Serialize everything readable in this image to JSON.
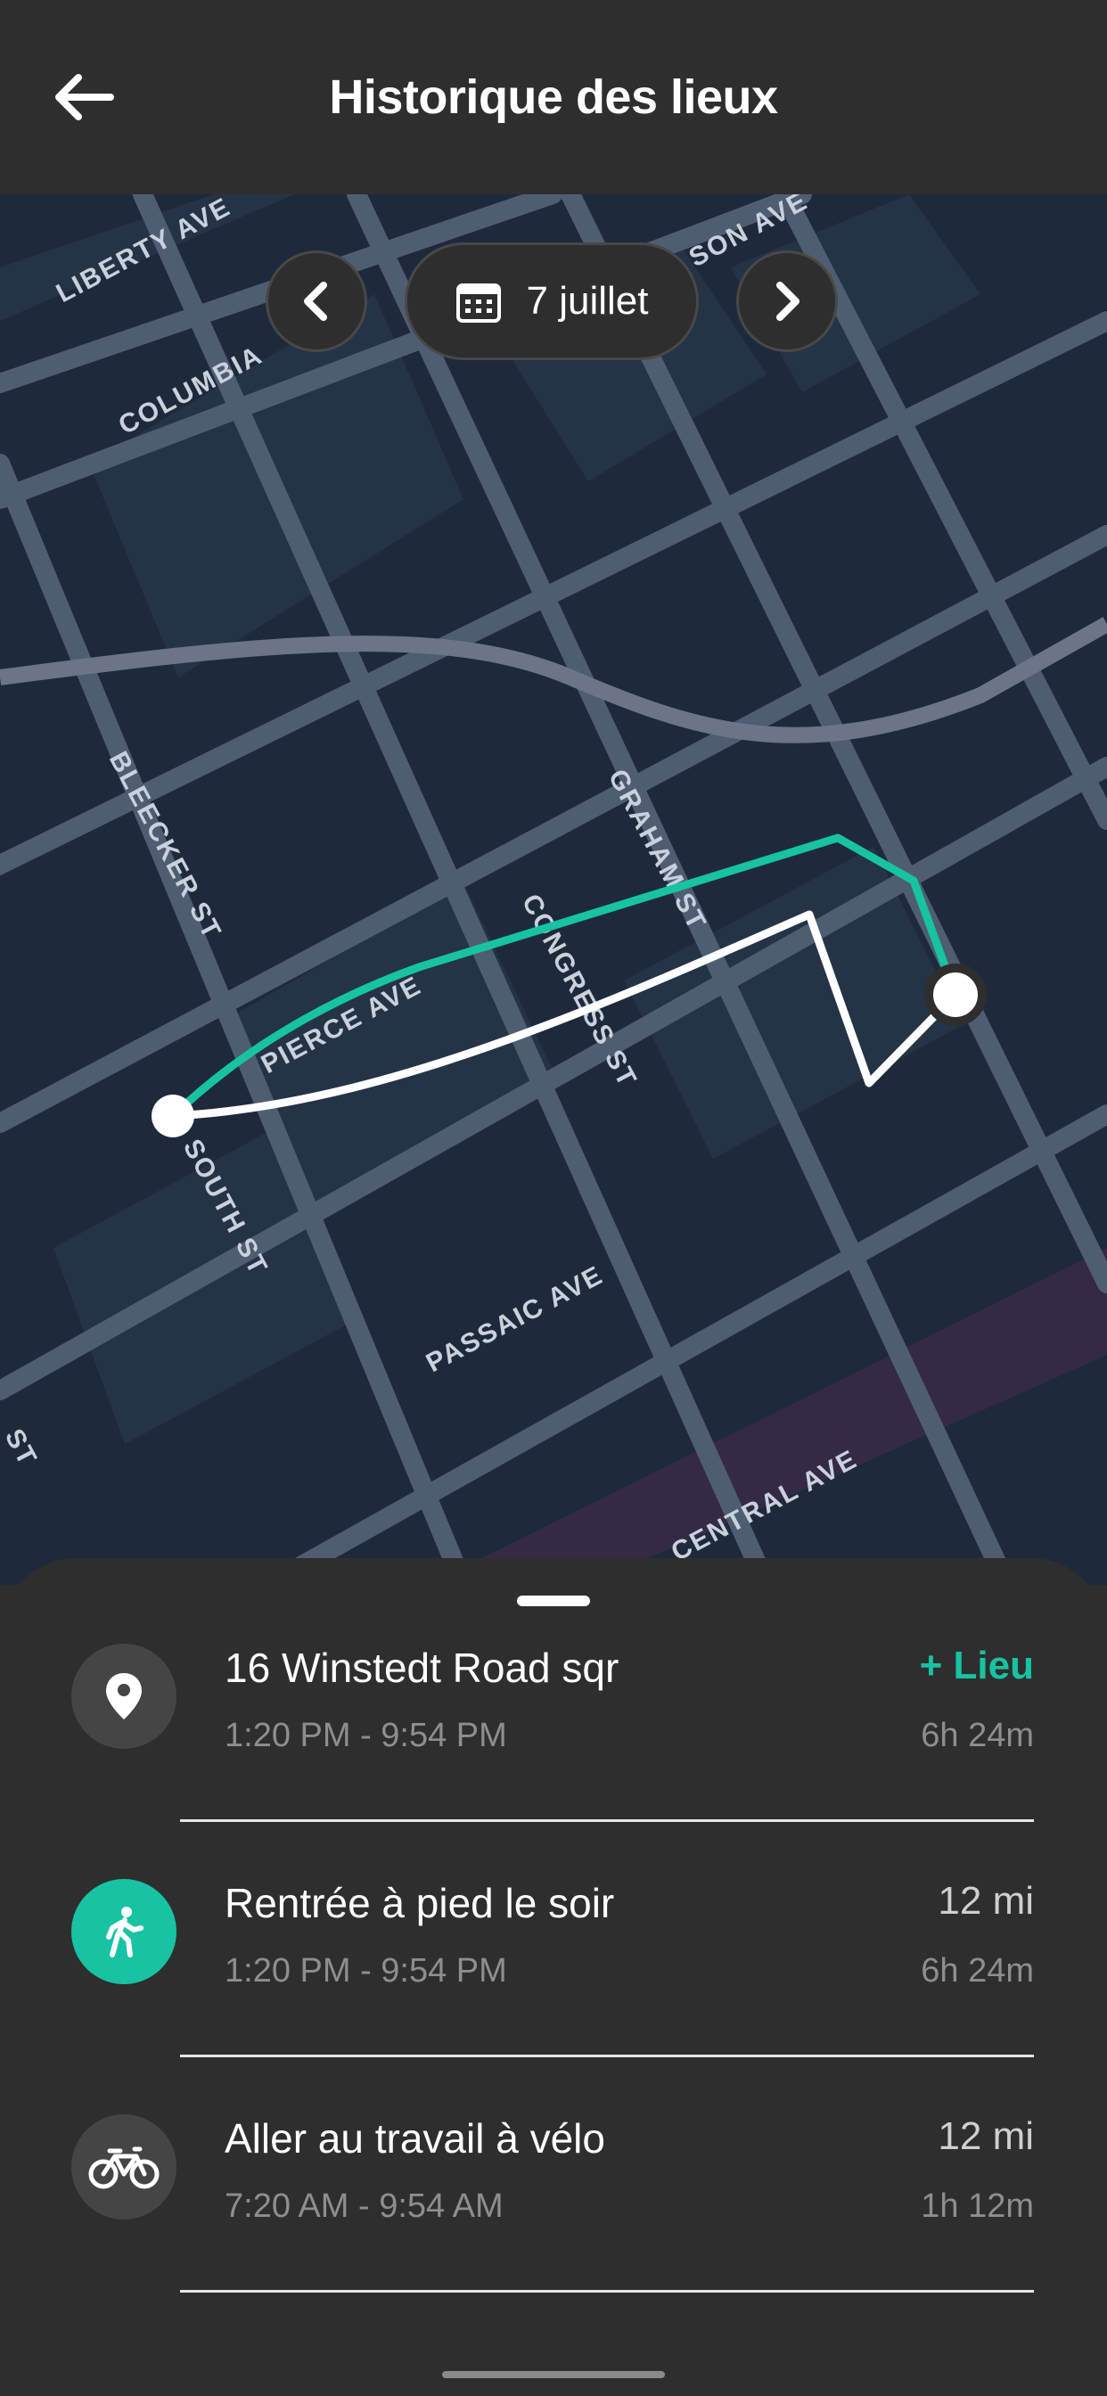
{
  "header": {
    "title": "Historique des lieux",
    "back_icon": "arrow-left-icon"
  },
  "date_nav": {
    "date_label": "7 juillet",
    "prev_icon": "chevron-left-icon",
    "next_icon": "chevron-right-icon",
    "calendar_icon": "calendar-icon"
  },
  "map": {
    "streets": [
      "LIBERTY AVE",
      "COLUMBIA",
      "SON AVE",
      "BLEECKER ST",
      "GRAHAM ST",
      "CONGRESS ST",
      "PIERCE AVE",
      "SOUTH ST",
      "PASSAIC AVE",
      "CENTRAL AVE",
      "ST"
    ],
    "colors": {
      "background": "#1e2a3b",
      "route_primary": "#17c3a3",
      "route_secondary": "#ffffff"
    }
  },
  "timeline": [
    {
      "name": "16 Winstedt Road sqr",
      "time": "1:20 PM - 9:54 PM",
      "right_top": "+ Lieu",
      "right_bottom": "6h 24m",
      "icon": "location-pin-icon",
      "active": false
    },
    {
      "name": "Rentrée à pied le soir",
      "time": "1:20 PM - 9:54 PM",
      "right_top": "12 mi",
      "right_bottom": "6h 24m",
      "icon": "walking-person-icon",
      "active": true
    },
    {
      "name": "Aller au travail à vélo",
      "time": "7:20 AM - 9:54 AM",
      "right_top": "12 mi",
      "right_bottom": "1h 12m",
      "icon": "bicycle-icon",
      "active": false
    }
  ],
  "colors": {
    "accent": "#17c3a3",
    "surface": "#2e2e2e"
  }
}
